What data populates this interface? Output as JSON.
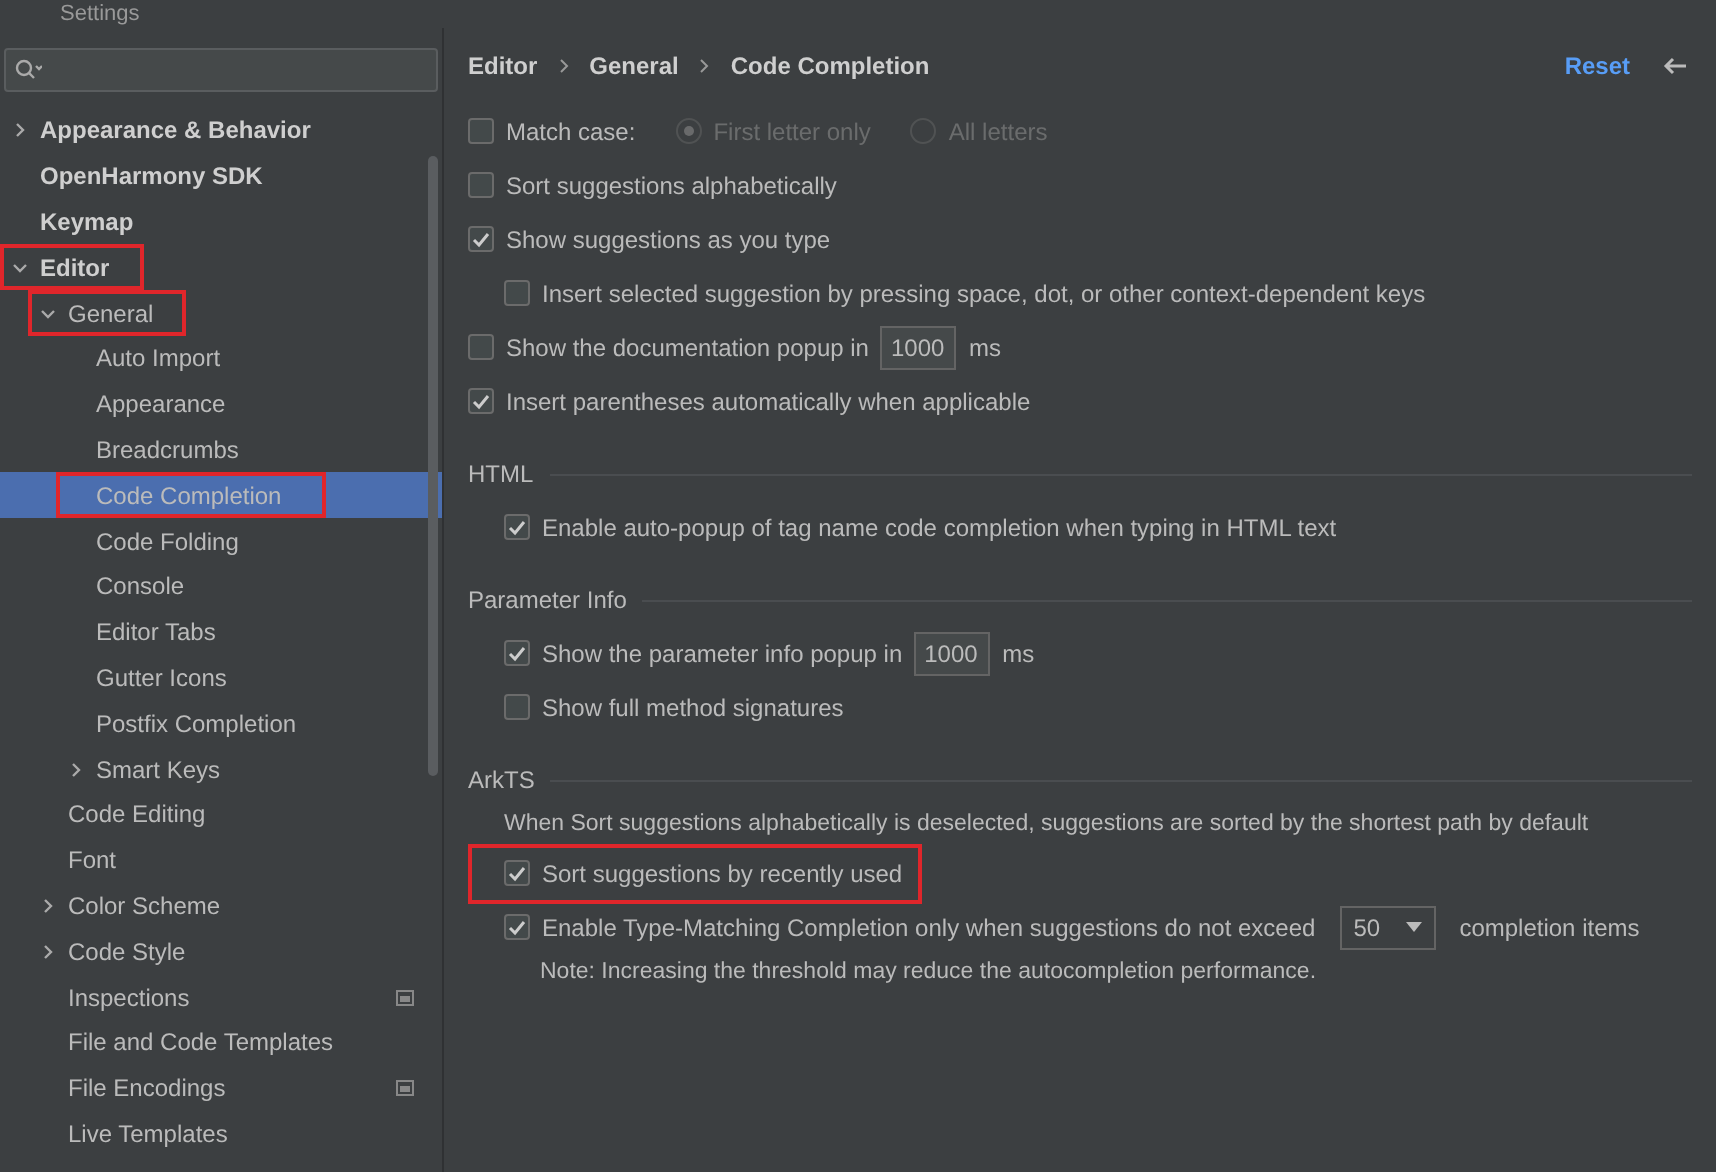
{
  "window": {
    "title": "Settings"
  },
  "tree": [
    {
      "label": "Appearance & Behavior",
      "bold": true,
      "expanded": false,
      "annotated": false,
      "selected": false
    },
    {
      "label": "OpenHarmony SDK",
      "bold": true,
      "annotated": false,
      "selected": false
    },
    {
      "label": "Keymap",
      "bold": true,
      "annotated": false,
      "selected": false
    },
    {
      "label": "Editor",
      "bold": true,
      "expanded": true,
      "annotated": true,
      "selected": false,
      "children": [
        {
          "label": "General",
          "expanded": true,
          "annotated": true,
          "selected": false,
          "children": [
            {
              "label": "Auto Import",
              "selected": false,
              "annotated": false
            },
            {
              "label": "Appearance",
              "selected": false,
              "annotated": false
            },
            {
              "label": "Breadcrumbs",
              "selected": false,
              "annotated": false
            },
            {
              "label": "Code Completion",
              "selected": true,
              "annotated": true
            },
            {
              "label": "Code Folding",
              "selected": false,
              "annotated": false
            },
            {
              "label": "Console",
              "selected": false,
              "annotated": false
            },
            {
              "label": "Editor Tabs",
              "selected": false,
              "annotated": false
            },
            {
              "label": "Gutter Icons",
              "selected": false,
              "annotated": false
            },
            {
              "label": "Postfix Completion",
              "selected": false,
              "annotated": false
            },
            {
              "label": "Smart Keys",
              "expanded": false,
              "selected": false,
              "annotated": false
            }
          ]
        },
        {
          "label": "Code Editing",
          "selected": false,
          "annotated": false
        },
        {
          "label": "Font",
          "selected": false,
          "annotated": false
        },
        {
          "label": "Color Scheme",
          "expanded": false,
          "selected": false,
          "annotated": false
        },
        {
          "label": "Code Style",
          "expanded": false,
          "selected": false,
          "annotated": false
        },
        {
          "label": "Inspections",
          "project_scoped": true,
          "selected": false,
          "annotated": false
        },
        {
          "label": "File and Code Templates",
          "selected": false,
          "annotated": false
        },
        {
          "label": "File Encodings",
          "project_scoped": true,
          "selected": false,
          "annotated": false
        },
        {
          "label": "Live Templates",
          "selected": false,
          "annotated": false
        }
      ]
    }
  ],
  "breadcrumbs": [
    "Editor",
    "General",
    "Code Completion"
  ],
  "reset_label": "Reset",
  "sections": [
    {
      "rows": [
        {
          "kind": "radio_group",
          "label": "Match case:",
          "checked": false,
          "annotated": false,
          "options": [
            {
              "label": "First letter only",
              "selected": true
            },
            {
              "label": "All letters",
              "selected": false
            }
          ]
        },
        {
          "kind": "checkbox",
          "label": "Sort suggestions alphabetically",
          "checked": false,
          "annotated": false
        },
        {
          "kind": "checkbox",
          "label": "Show suggestions as you type",
          "checked": true,
          "annotated": false,
          "children": [
            {
              "kind": "checkbox",
              "label": "Insert selected suggestion by pressing space, dot, or other context-dependent keys",
              "checked": false,
              "annotated": false
            }
          ]
        },
        {
          "kind": "field",
          "label": "Show the documentation popup in",
          "value": "1000",
          "unit": "ms",
          "checked": false,
          "annotated": false
        },
        {
          "kind": "checkbox",
          "label": "Insert parentheses automatically when applicable",
          "checked": true,
          "annotated": false
        }
      ]
    },
    {
      "title": "HTML",
      "rows": [
        {
          "kind": "checkbox",
          "label": "Enable auto-popup of tag name code completion when typing in HTML text",
          "checked": true,
          "annotated": false
        }
      ]
    },
    {
      "title": "Parameter Info",
      "rows": [
        {
          "kind": "field",
          "label": "Show the parameter info popup in",
          "value": "1000",
          "unit": "ms",
          "checked": true,
          "annotated": false
        },
        {
          "kind": "checkbox",
          "label": "Show full method signatures",
          "checked": false,
          "annotated": false
        }
      ]
    },
    {
      "title": "ArkTS",
      "rows": [
        {
          "kind": "note",
          "label": "When Sort suggestions alphabetically is deselected, suggestions are sorted by the shortest path by default"
        },
        {
          "kind": "checkbox",
          "label": "Sort suggestions by recently used",
          "checked": true,
          "annotated": true
        },
        {
          "kind": "dropdown",
          "label": "Enable Type-Matching Completion only when suggestions do not exceed",
          "value": "50",
          "unit": "completion items",
          "checked": true,
          "annotated": false,
          "children": [
            {
              "kind": "note",
              "label": "Note: Increasing the threshold may reduce the autocompletion performance."
            }
          ]
        }
      ]
    }
  ]
}
